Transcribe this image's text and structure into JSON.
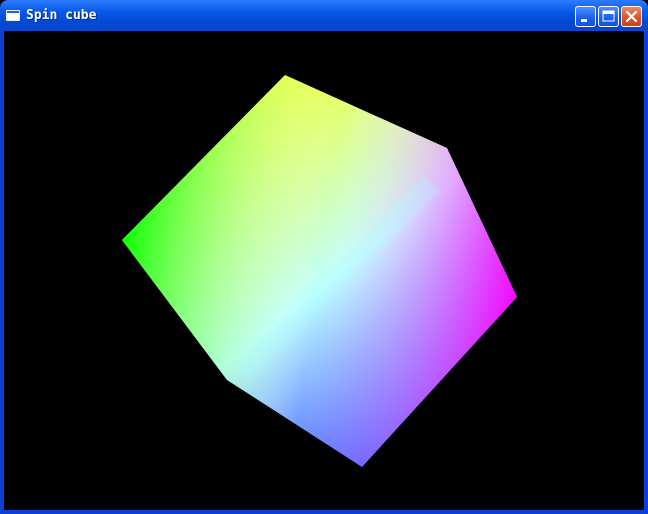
{
  "window": {
    "title": "Spin cube",
    "icon": "window-app-icon",
    "controls": [
      "minimize-icon",
      "maximize-icon",
      "close-icon"
    ]
  },
  "canvas": {
    "background": "#000000",
    "vertex_colors": {
      "yellow": "#ffff00",
      "white": "#ffffff",
      "green": "#00ff00",
      "magenta": "#ff00ff",
      "cyan": "#00ffff",
      "blue": "#0000ff"
    }
  }
}
